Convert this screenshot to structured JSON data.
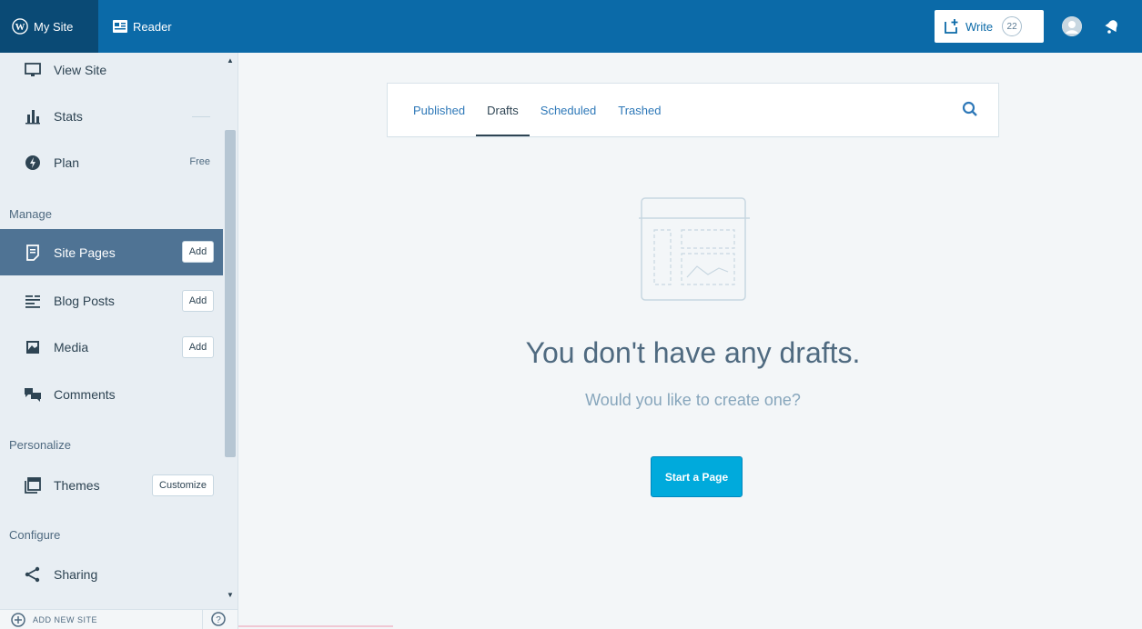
{
  "masterbar": {
    "my_site": "My Site",
    "reader": "Reader",
    "write": "Write",
    "write_count": "22"
  },
  "sidebar": {
    "items": [
      {
        "label": "View Site",
        "icon": "monitor-icon"
      },
      {
        "label": "Stats",
        "icon": "bar-chart-icon"
      },
      {
        "label": "Plan",
        "icon": "plan-icon",
        "badge": "Free"
      },
      {
        "label": "Site Pages",
        "icon": "page-icon",
        "action": "Add"
      },
      {
        "label": "Blog Posts",
        "icon": "posts-icon",
        "action": "Add"
      },
      {
        "label": "Media",
        "icon": "image-icon",
        "action": "Add"
      },
      {
        "label": "Comments",
        "icon": "comments-icon"
      },
      {
        "label": "Themes",
        "icon": "themes-icon",
        "action": "Customize"
      },
      {
        "label": "Sharing",
        "icon": "share-icon"
      }
    ],
    "headings": {
      "manage": "Manage",
      "personalize": "Personalize",
      "configure": "Configure"
    },
    "footer": {
      "add_new_site": "ADD NEW SITE"
    }
  },
  "section_nav": {
    "tabs": [
      "Published",
      "Drafts",
      "Scheduled",
      "Trashed"
    ],
    "current": "Drafts"
  },
  "empty_state": {
    "title": "You don't have any drafts.",
    "subtitle": "Would you like to create one?",
    "action": "Start a Page"
  },
  "colors": {
    "masterbar": "#0b6aa8",
    "selected_item": "#4f7394",
    "primary_button": "#00aadc"
  }
}
